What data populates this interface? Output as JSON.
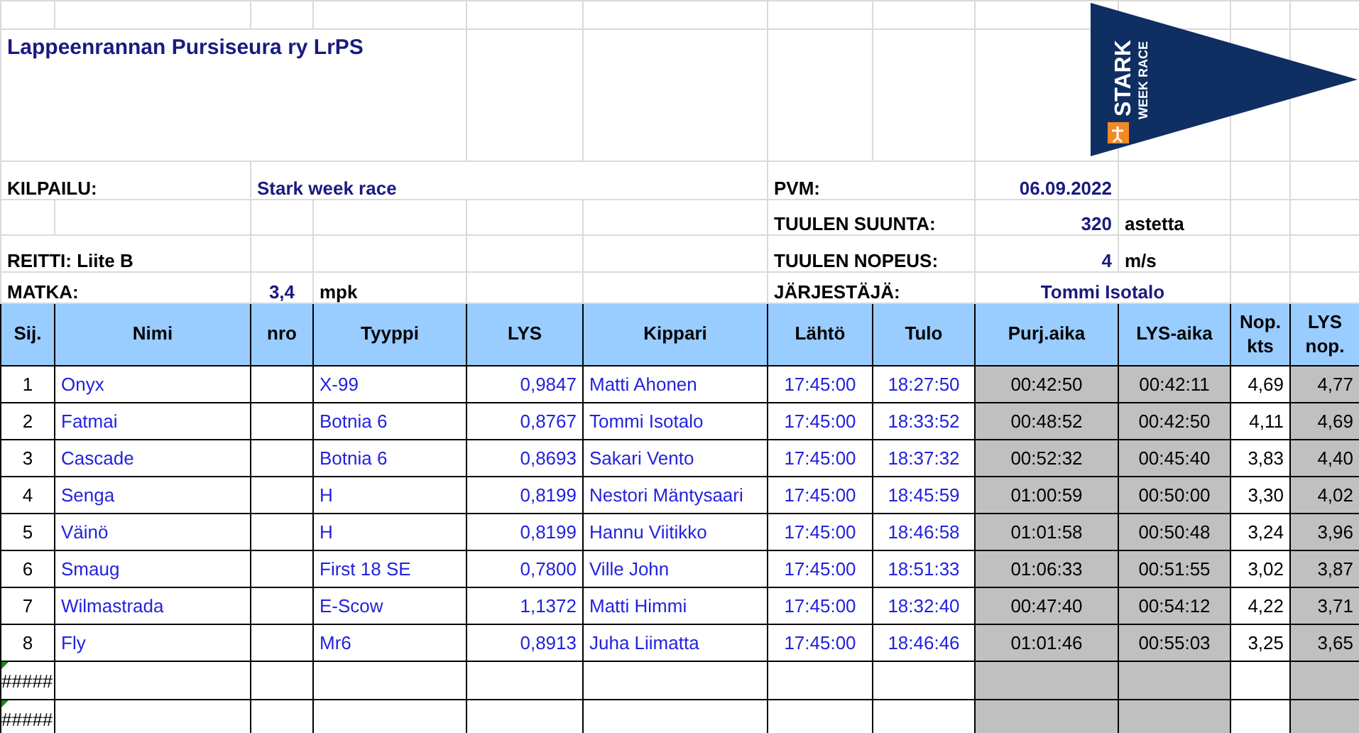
{
  "title": "Lappeenrannan Pursiseura ry LrPS",
  "logo": {
    "line1": "STARK",
    "line2": "WEEK RACE"
  },
  "info": {
    "kilpailu_label": "KILPAILU:",
    "kilpailu": "Stark week race",
    "pvm_label": "PVM:",
    "pvm": "06.09.2022",
    "suunta_label": "TUULEN SUUNTA:",
    "suunta": "320",
    "suunta_unit": "astetta",
    "reitti": "REITTI: Liite B",
    "nopeus_label": "TUULEN NOPEUS:",
    "nopeus": "4",
    "nopeus_unit": "m/s",
    "matka_label": "MATKA:",
    "matka": "3,4",
    "matka_unit": "mpk",
    "jarjestaja_label": "JÄRJESTÄJÄ:",
    "jarjestaja": "Tommi Isotalo"
  },
  "columns": [
    "Sij.",
    "Nimi",
    "nro",
    "Tyyppi",
    "LYS",
    "Kippari",
    "Lähtö",
    "Tulo",
    "Purj.aika",
    "LYS-aika",
    "Nop. kts",
    "LYS nop."
  ],
  "rows": [
    {
      "cells": [
        "1",
        "Onyx",
        "",
        "X-99",
        "0,9847",
        "Matti Ahonen",
        "17:45:00",
        "18:27:50",
        "00:42:50",
        "00:42:11",
        "4,69",
        "4,77"
      ]
    },
    {
      "cells": [
        "2",
        "Fatmai",
        "",
        "Botnia 6",
        "0,8767",
        "Tommi Isotalo",
        "17:45:00",
        "18:33:52",
        "00:48:52",
        "00:42:50",
        "4,11",
        "4,69"
      ]
    },
    {
      "cells": [
        "3",
        "Cascade",
        "",
        "Botnia 6",
        "0,8693",
        "Sakari Vento",
        "17:45:00",
        "18:37:32",
        "00:52:32",
        "00:45:40",
        "3,83",
        "4,40"
      ]
    },
    {
      "cells": [
        "4",
        "Senga",
        "",
        "H",
        "0,8199",
        "Nestori Mäntysaari",
        "17:45:00",
        "18:45:59",
        "01:00:59",
        "00:50:00",
        "3,30",
        "4,02"
      ]
    },
    {
      "cells": [
        "5",
        "Väinö",
        "",
        "H",
        "0,8199",
        "Hannu Viitikko",
        "17:45:00",
        "18:46:58",
        "01:01:58",
        "00:50:48",
        "3,24",
        "3,96"
      ]
    },
    {
      "cells": [
        "6",
        "Smaug",
        "",
        "First 18 SE",
        "0,7800",
        "Ville John",
        "17:45:00",
        "18:51:33",
        "01:06:33",
        "00:51:55",
        "3,02",
        "3,87"
      ]
    },
    {
      "cells": [
        "7",
        "Wilmastrada",
        "",
        "E-Scow",
        "1,1372",
        "Matti Himmi",
        "17:45:00",
        "18:32:40",
        "00:47:40",
        "00:54:12",
        "4,22",
        "3,71"
      ]
    },
    {
      "cells": [
        "8",
        "Fly",
        "",
        "Mr6",
        "0,8913",
        "Juha Liimatta",
        "17:45:00",
        "18:46:46",
        "01:01:46",
        "00:55:03",
        "3,25",
        "3,65"
      ]
    }
  ],
  "error_rows": [
    {
      "text": "#####",
      "flagged": true
    },
    {
      "text": "#####",
      "flagged": true
    }
  ]
}
